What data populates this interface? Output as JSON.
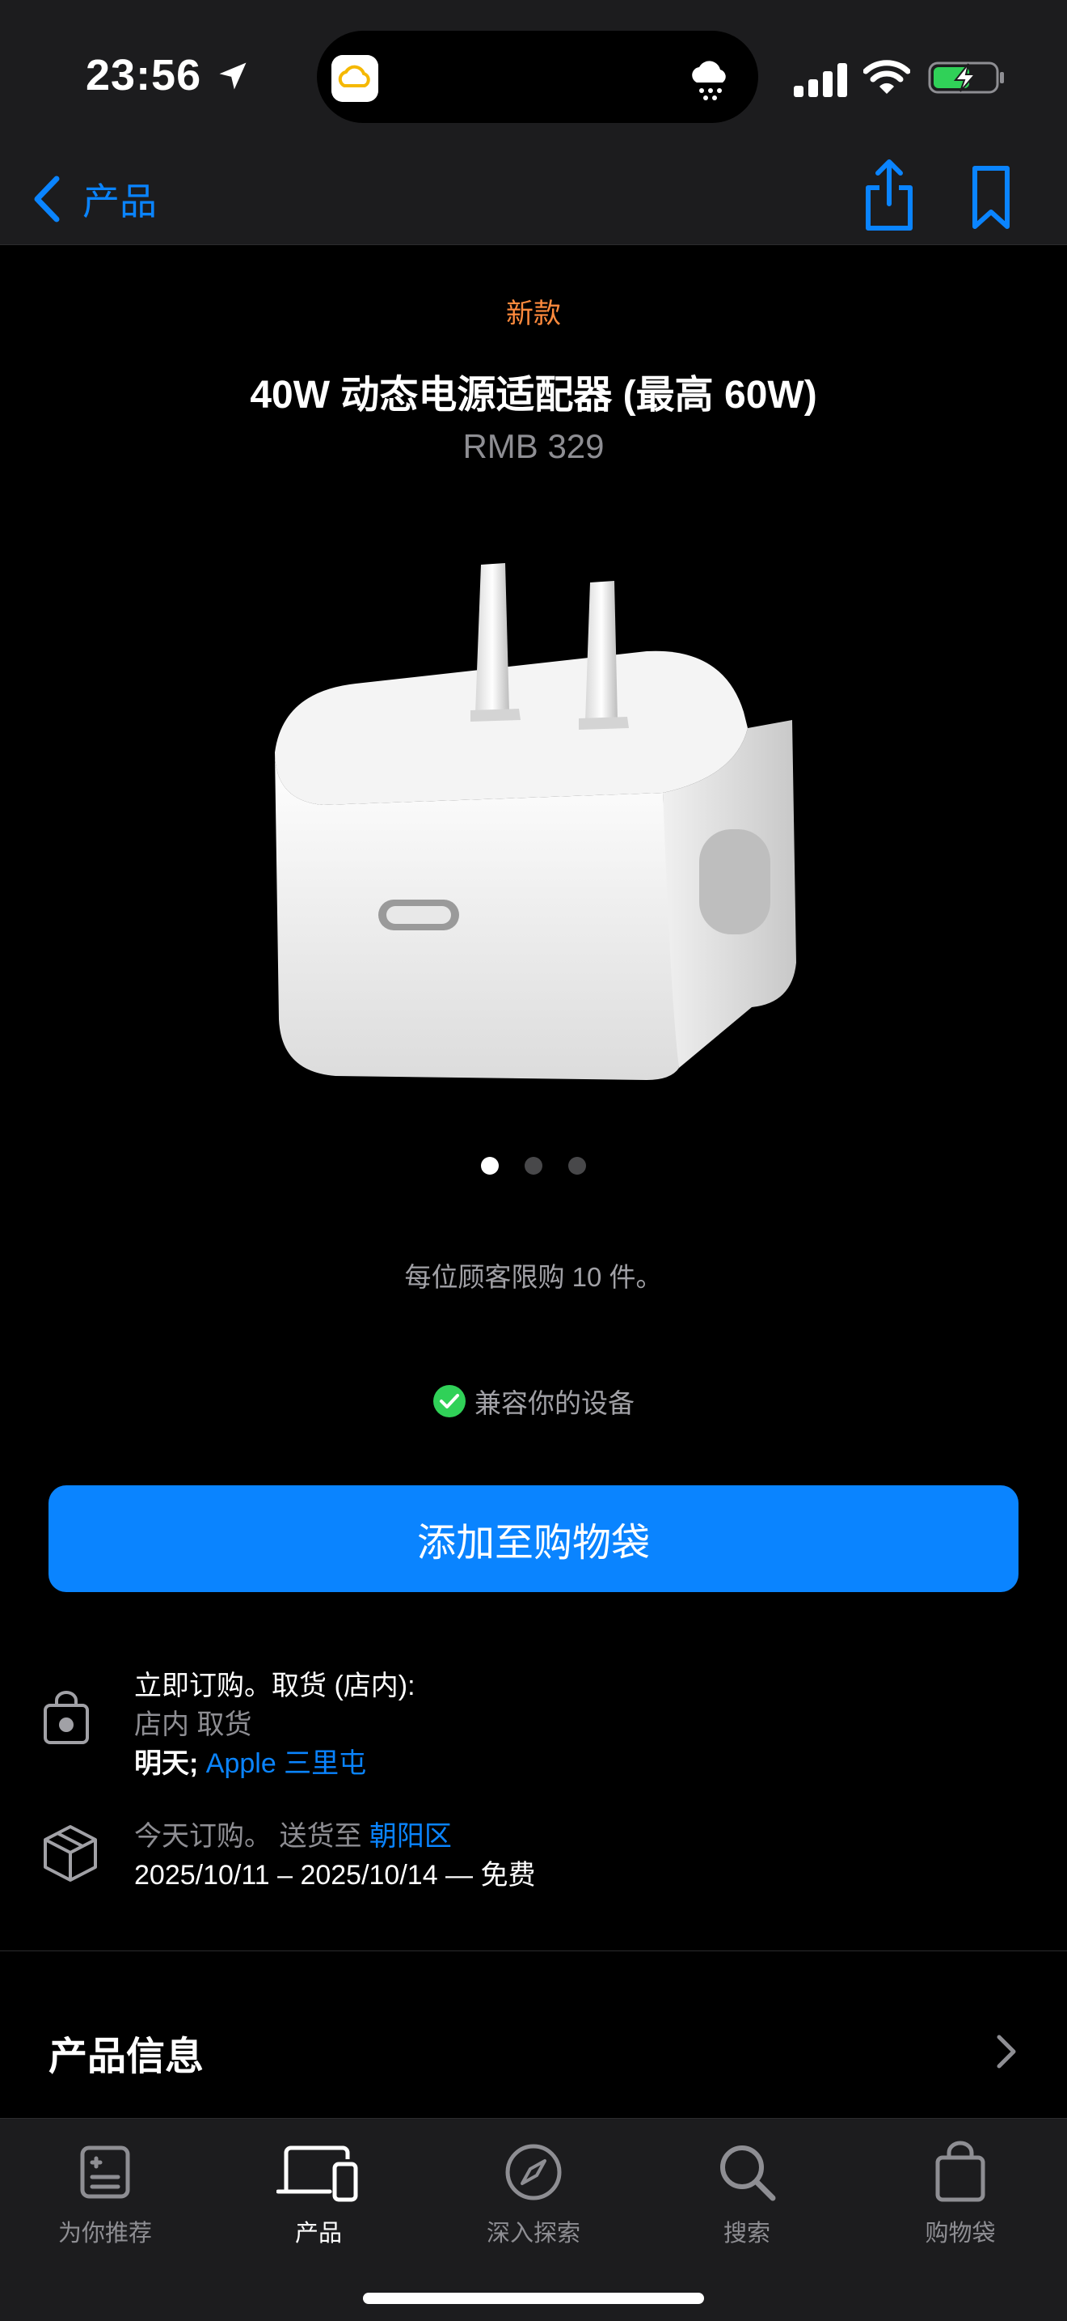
{
  "status_bar": {
    "time": "23:56"
  },
  "nav": {
    "back_label": "产品"
  },
  "product": {
    "badge": "新款",
    "title": "40W 动态电源适配器 (最高 60W)",
    "price": "RMB 329",
    "image_pages": 3,
    "current_image": 1
  },
  "limit_text": "每位顾客限购 10 件。",
  "compat_text": "兼容你的设备",
  "add_to_bag_label": "添加至购物袋",
  "pickup": {
    "line1": "立即订购。取货 (店内):",
    "line2": "店内 取货",
    "day": "明天;",
    "store": "Apple 三里屯"
  },
  "delivery": {
    "prefix": "今天订购。 送货至",
    "area": "朝阳区",
    "dates": "2025/10/11 – 2025/10/14 — 免费"
  },
  "info_section": {
    "title": "产品信息"
  },
  "tabs": [
    {
      "label": "为你推荐",
      "icon": "for-you-icon",
      "active": false
    },
    {
      "label": "产品",
      "icon": "products-icon",
      "active": true
    },
    {
      "label": "深入探索",
      "icon": "compass-icon",
      "active": false
    },
    {
      "label": "搜索",
      "icon": "search-icon",
      "active": false
    },
    {
      "label": "购物袋",
      "icon": "bag-icon",
      "active": false
    }
  ],
  "colors": {
    "accent": "#0a84ff",
    "badge": "#ff8a3d",
    "check": "#30d158",
    "background": "#000000",
    "bar": "#1c1c1e"
  }
}
